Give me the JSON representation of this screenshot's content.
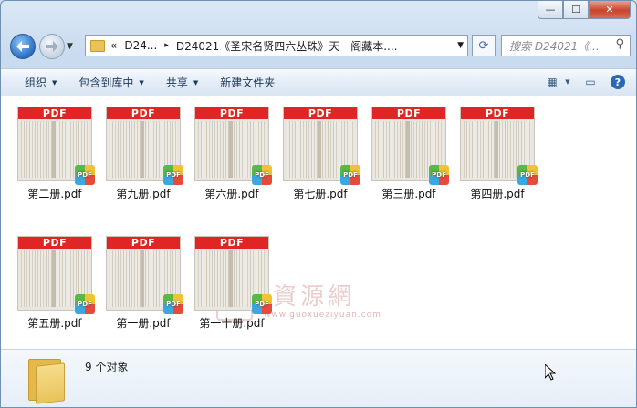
{
  "nav": {
    "history_glyph": "▼",
    "address_segments": [
      "«",
      "D24...",
      "▸",
      "D24021《圣宋名贤四六丛珠》天一阁藏本...."
    ],
    "search_placeholder": "搜索 D24021《...",
    "refresh_icon": "refresh-icon",
    "search_icon": "search-icon"
  },
  "toolbar": {
    "items": [
      "组织",
      "包含到库中",
      "共享",
      "新建文件夹"
    ],
    "has_dropdown": [
      true,
      true,
      true,
      false
    ],
    "view_icon": "view-options-icon",
    "preview_icon": "preview-pane-icon",
    "help_label": "?"
  },
  "files": [
    {
      "name": "第二册.pdf",
      "badge": "PDF"
    },
    {
      "name": "第九册.pdf",
      "badge": "PDF"
    },
    {
      "name": "第六册.pdf",
      "badge": "PDF"
    },
    {
      "name": "第七册.pdf",
      "badge": "PDF"
    },
    {
      "name": "第三册.pdf",
      "badge": "PDF"
    },
    {
      "name": "第四册.pdf",
      "badge": "PDF"
    },
    {
      "name": "第五册.pdf",
      "badge": "PDF"
    },
    {
      "name": "第一册.pdf",
      "badge": "PDF"
    },
    {
      "name": "第一十册.pdf",
      "badge": "PDF"
    }
  ],
  "thumb_band": "PDF",
  "watermark": {
    "text": "國學資源網",
    "url": "www.guoxueziyuan.com"
  },
  "details": {
    "count": "9 个对象"
  },
  "colors": {
    "pdf_red": "#e02525",
    "accent": "#2a6fc0"
  }
}
